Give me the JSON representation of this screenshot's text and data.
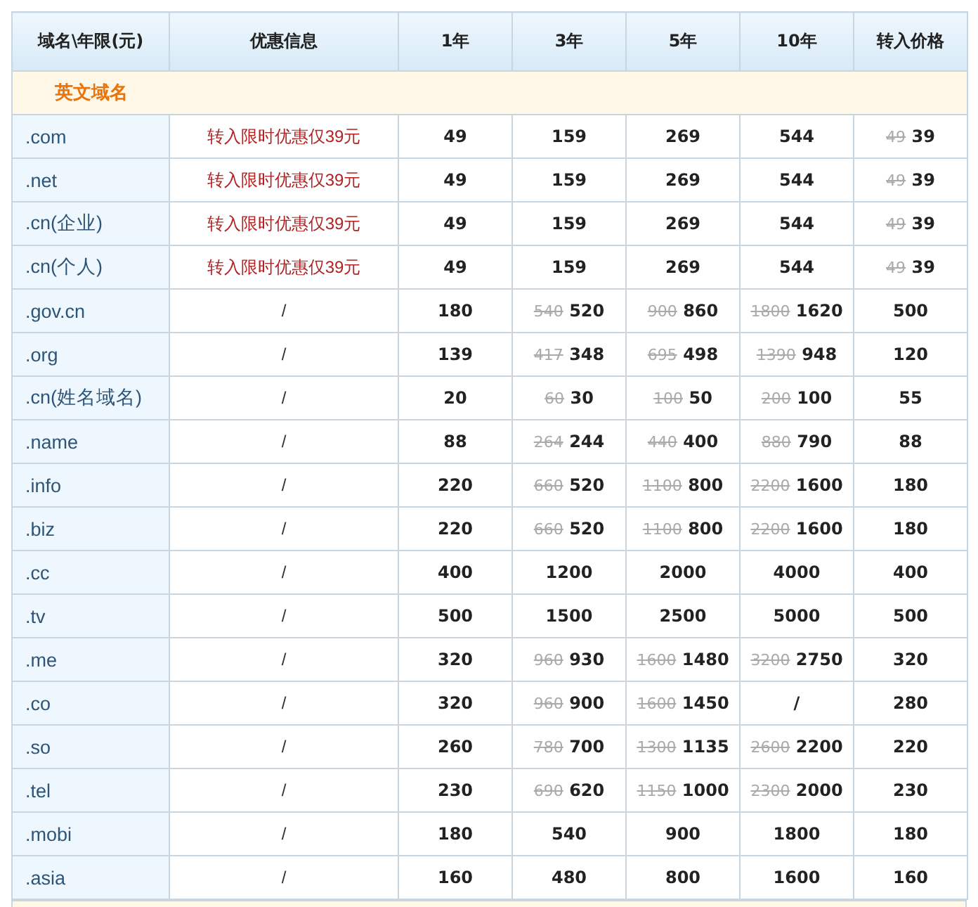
{
  "table": {
    "columns": [
      "域名\\年限(元)",
      "优惠信息",
      "1年",
      "3年",
      "5年",
      "10年",
      "转入价格"
    ],
    "section": "英文域名",
    "rows": [
      {
        "domain": ".com",
        "promo": "转入限时优惠仅39元",
        "promo_highlight": true,
        "prices": [
          {
            "price": "49"
          },
          {
            "price": "159"
          },
          {
            "price": "269"
          },
          {
            "price": "544"
          },
          {
            "old": "49",
            "price": "39"
          }
        ]
      },
      {
        "domain": ".net",
        "promo": "转入限时优惠仅39元",
        "promo_highlight": true,
        "prices": [
          {
            "price": "49"
          },
          {
            "price": "159"
          },
          {
            "price": "269"
          },
          {
            "price": "544"
          },
          {
            "old": "49",
            "price": "39"
          }
        ]
      },
      {
        "domain": ".cn(企业)",
        "promo": "转入限时优惠仅39元",
        "promo_highlight": true,
        "prices": [
          {
            "price": "49"
          },
          {
            "price": "159"
          },
          {
            "price": "269"
          },
          {
            "price": "544"
          },
          {
            "old": "49",
            "price": "39"
          }
        ]
      },
      {
        "domain": ".cn(个人)",
        "promo": "转入限时优惠仅39元",
        "promo_highlight": true,
        "prices": [
          {
            "price": "49"
          },
          {
            "price": "159"
          },
          {
            "price": "269"
          },
          {
            "price": "544"
          },
          {
            "old": "49",
            "price": "39"
          }
        ]
      },
      {
        "domain": ".gov.cn",
        "promo": "/",
        "promo_highlight": false,
        "prices": [
          {
            "price": "180"
          },
          {
            "old": "540",
            "price": "520"
          },
          {
            "old": "900",
            "price": "860"
          },
          {
            "old": "1800",
            "price": "1620"
          },
          {
            "price": "500"
          }
        ]
      },
      {
        "domain": ".org",
        "promo": "/",
        "promo_highlight": false,
        "prices": [
          {
            "price": "139"
          },
          {
            "old": "417",
            "price": "348"
          },
          {
            "old": "695",
            "price": "498"
          },
          {
            "old": "1390",
            "price": "948"
          },
          {
            "price": "120"
          }
        ]
      },
      {
        "domain": ".cn(姓名域名)",
        "promo": "/",
        "promo_highlight": false,
        "prices": [
          {
            "price": "20"
          },
          {
            "old": "60",
            "price": "30"
          },
          {
            "old": "100",
            "price": "50"
          },
          {
            "old": "200",
            "price": "100"
          },
          {
            "price": "55"
          }
        ]
      },
      {
        "domain": ".name",
        "promo": "/",
        "promo_highlight": false,
        "prices": [
          {
            "price": "88"
          },
          {
            "old": "264",
            "price": "244"
          },
          {
            "old": "440",
            "price": "400"
          },
          {
            "old": "880",
            "price": "790"
          },
          {
            "price": "88"
          }
        ]
      },
      {
        "domain": ".info",
        "promo": "/",
        "promo_highlight": false,
        "prices": [
          {
            "price": "220"
          },
          {
            "old": "660",
            "price": "520"
          },
          {
            "old": "1100",
            "price": "800"
          },
          {
            "old": "2200",
            "price": "1600"
          },
          {
            "price": "180"
          }
        ]
      },
      {
        "domain": ".biz",
        "promo": "/",
        "promo_highlight": false,
        "prices": [
          {
            "price": "220"
          },
          {
            "old": "660",
            "price": "520"
          },
          {
            "old": "1100",
            "price": "800"
          },
          {
            "old": "2200",
            "price": "1600"
          },
          {
            "price": "180"
          }
        ]
      },
      {
        "domain": ".cc",
        "promo": "/",
        "promo_highlight": false,
        "prices": [
          {
            "price": "400"
          },
          {
            "price": "1200"
          },
          {
            "price": "2000"
          },
          {
            "price": "4000"
          },
          {
            "price": "400"
          }
        ]
      },
      {
        "domain": ".tv",
        "promo": "/",
        "promo_highlight": false,
        "prices": [
          {
            "price": "500"
          },
          {
            "price": "1500"
          },
          {
            "price": "2500"
          },
          {
            "price": "5000"
          },
          {
            "price": "500"
          }
        ]
      },
      {
        "domain": ".me",
        "promo": "/",
        "promo_highlight": false,
        "prices": [
          {
            "price": "320"
          },
          {
            "old": "960",
            "price": "930"
          },
          {
            "old": "1600",
            "price": "1480"
          },
          {
            "old": "3200",
            "price": "2750"
          },
          {
            "price": "320"
          }
        ]
      },
      {
        "domain": ".co",
        "promo": "/",
        "promo_highlight": false,
        "prices": [
          {
            "price": "320"
          },
          {
            "old": "960",
            "price": "900"
          },
          {
            "old": "1600",
            "price": "1450"
          },
          {
            "price": "/"
          },
          {
            "price": "280"
          }
        ]
      },
      {
        "domain": ".so",
        "promo": "/",
        "promo_highlight": false,
        "prices": [
          {
            "price": "260"
          },
          {
            "old": "780",
            "price": "700"
          },
          {
            "old": "1300",
            "price": "1135"
          },
          {
            "old": "2600",
            "price": "2200"
          },
          {
            "price": "220"
          }
        ]
      },
      {
        "domain": ".tel",
        "promo": "/",
        "promo_highlight": false,
        "prices": [
          {
            "price": "230"
          },
          {
            "old": "690",
            "price": "620"
          },
          {
            "old": "1150",
            "price": "1000"
          },
          {
            "old": "2300",
            "price": "2000"
          },
          {
            "price": "230"
          }
        ]
      },
      {
        "domain": ".mobi",
        "promo": "/",
        "promo_highlight": false,
        "prices": [
          {
            "price": "180"
          },
          {
            "price": "540"
          },
          {
            "price": "900"
          },
          {
            "price": "1800"
          },
          {
            "price": "180"
          }
        ]
      },
      {
        "domain": ".asia",
        "promo": "/",
        "promo_highlight": false,
        "prices": [
          {
            "price": "160"
          },
          {
            "price": "480"
          },
          {
            "price": "800"
          },
          {
            "price": "1600"
          },
          {
            "price": "160"
          }
        ]
      }
    ]
  }
}
